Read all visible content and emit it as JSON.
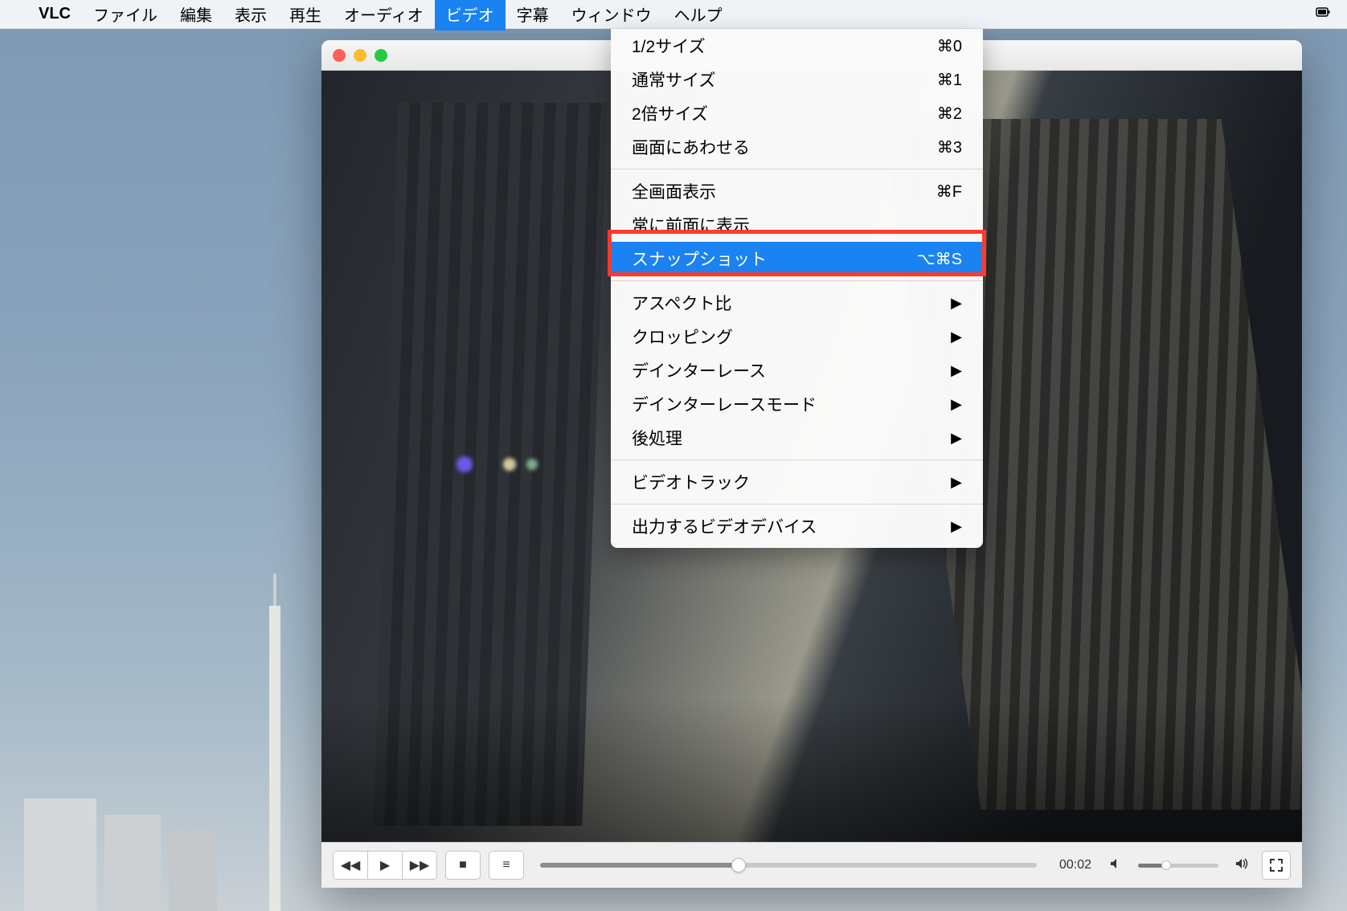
{
  "menubar": {
    "app": "VLC",
    "items": [
      "ファイル",
      "編集",
      "表示",
      "再生",
      "オーディオ",
      "ビデオ",
      "字幕",
      "ウィンドウ",
      "ヘルプ"
    ],
    "active_index": 5
  },
  "dropdown": {
    "groups": [
      [
        {
          "label": "1/2サイズ",
          "shortcut": "⌘0"
        },
        {
          "label": "通常サイズ",
          "shortcut": "⌘1"
        },
        {
          "label": "2倍サイズ",
          "shortcut": "⌘2"
        },
        {
          "label": "画面にあわせる",
          "shortcut": "⌘3"
        }
      ],
      [
        {
          "label": "全画面表示",
          "shortcut": "⌘F"
        },
        {
          "label": "常に前面に表示",
          "shortcut": ""
        },
        {
          "label": "スナップショット",
          "shortcut": "⌥⌘S",
          "highlight": true
        }
      ],
      [
        {
          "label": "アスペクト比",
          "submenu": true
        },
        {
          "label": "クロッピング",
          "submenu": true
        },
        {
          "label": "デインターレース",
          "submenu": true
        },
        {
          "label": "デインターレースモード",
          "submenu": true
        },
        {
          "label": "後処理",
          "submenu": true
        }
      ],
      [
        {
          "label": "ビデオトラック",
          "submenu": true
        }
      ],
      [
        {
          "label": "出力するビデオデバイス",
          "submenu": true
        }
      ]
    ]
  },
  "player": {
    "time": "00:02"
  }
}
